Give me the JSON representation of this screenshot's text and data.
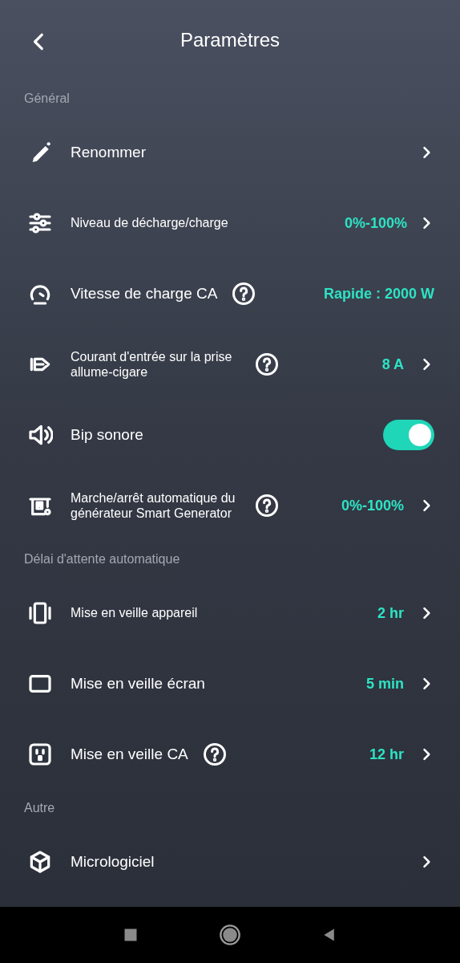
{
  "header": {
    "title": "Paramètres"
  },
  "sections": [
    {
      "title": "Général",
      "items": [
        {
          "kind": "link",
          "label": "Renommer"
        },
        {
          "kind": "link",
          "label": "Niveau de décharge/charge",
          "small": true,
          "value": "0%-100%"
        },
        {
          "kind": "value",
          "label": "Vitesse de charge CA",
          "help": true,
          "value": "Rapide : 2000 W"
        },
        {
          "kind": "link",
          "label": "Courant d'entrée sur la prise allume-cigare",
          "small": true,
          "help": true,
          "value": "8 A"
        },
        {
          "kind": "toggle",
          "label": "Bip sonore",
          "on": true
        },
        {
          "kind": "link",
          "label": "Marche/arrêt automatique du générateur Smart Generator",
          "small": true,
          "help": true,
          "value": "0%-100%"
        }
      ]
    },
    {
      "title": "Délai d'attente automatique",
      "items": [
        {
          "kind": "link",
          "label": "Mise en veille appareil",
          "small": true,
          "value": "2 hr"
        },
        {
          "kind": "link",
          "label": "Mise en veille écran",
          "value": "5 min"
        },
        {
          "kind": "link",
          "label": "Mise en veille CA",
          "help": true,
          "value": "12 hr"
        }
      ]
    },
    {
      "title": "Autre",
      "items": [
        {
          "kind": "link",
          "label": "Micrologiciel"
        }
      ]
    }
  ]
}
